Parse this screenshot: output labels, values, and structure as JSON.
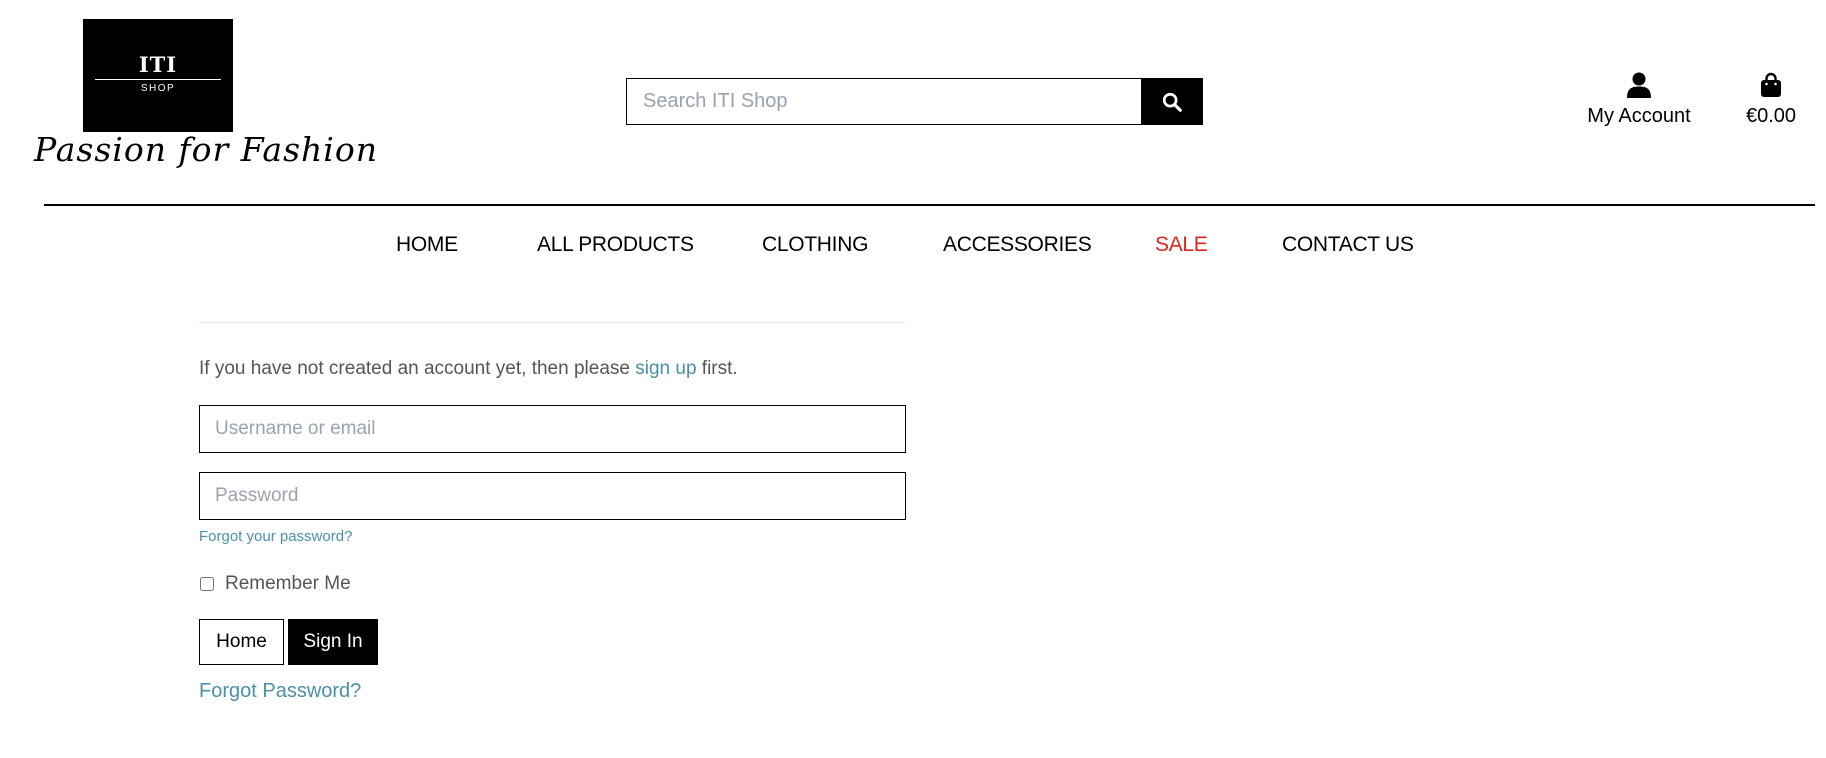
{
  "brand": {
    "logo_title": "ITI",
    "logo_sub": "SHOP",
    "tagline": "Passion for Fashion"
  },
  "search": {
    "placeholder": "Search ITI Shop",
    "icon": "search-icon"
  },
  "account": {
    "label": "My Account",
    "icon": "user-icon"
  },
  "bag": {
    "total": "€0.00",
    "icon": "shopping-bag-icon"
  },
  "nav": {
    "home": "HOME",
    "all_products": "ALL PRODUCTS",
    "clothing": "CLOTHING",
    "accessories": "ACCESSORIES",
    "sale": "SALE",
    "contact": "CONTACT US"
  },
  "colors": {
    "sale": "#d9261c",
    "link": "#4a90a8",
    "text": "#555555"
  },
  "login": {
    "intro_before": "If you have not created an account yet, then please ",
    "signup_link": "sign up",
    "intro_after": " first.",
    "username_placeholder": "Username or email",
    "password_placeholder": "Password",
    "forgot_small": "Forgot your password?",
    "remember_label": "Remember Me",
    "home_button": "Home",
    "signin_button": "Sign In",
    "forgot_big": "Forgot Password?"
  }
}
